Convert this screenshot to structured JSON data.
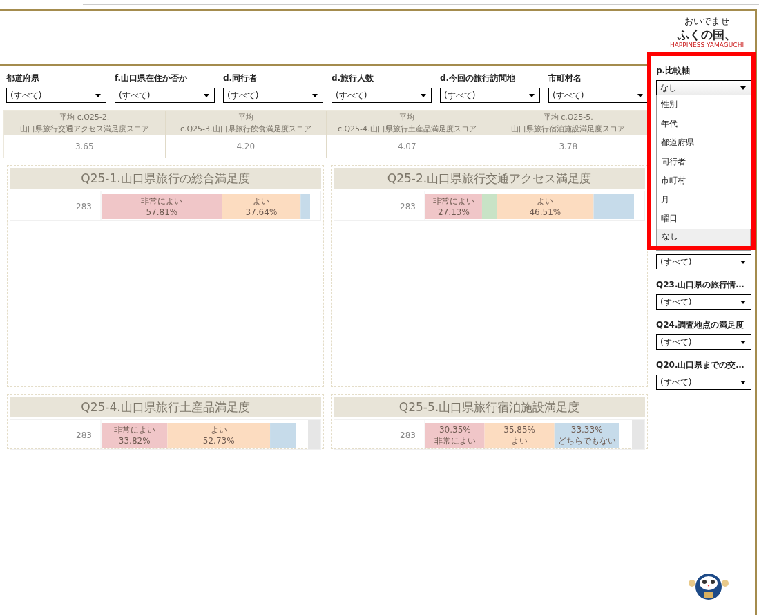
{
  "filters": [
    {
      "label": "都道府県",
      "value": "(すべて)"
    },
    {
      "label": "f.山口県在住か否か",
      "value": "(すべて)"
    },
    {
      "label": "d.同行者",
      "value": "(すべて)"
    },
    {
      "label": "d.旅行人数",
      "value": "(すべて)"
    },
    {
      "label": "d.今回の旅行訪問地",
      "value": "(すべて)"
    },
    {
      "label": "市町村名",
      "value": "(すべて)"
    }
  ],
  "kpi_table": {
    "columns": [
      [
        "平均 c.Q25-2.",
        "山口県旅行交通アクセス満足度スコア"
      ],
      [
        "平均",
        "c.Q25-3.山口県旅行飲食満足度スコア"
      ],
      [
        "平均",
        "c.Q25-4.山口県旅行土産品満足度スコア"
      ],
      [
        "平均 c.Q25-5.",
        "山口県旅行宿泊施設満足度スコア"
      ]
    ],
    "values": [
      "3.65",
      "4.20",
      "4.07",
      "3.78"
    ]
  },
  "panels": [
    {
      "title": "Q25-1.山口県旅行の総合満足度",
      "tall": true,
      "scrollbar": false,
      "value_first": false,
      "chart_data": {
        "type": "bar",
        "orientation": "horizontal",
        "stacked": true,
        "categories": [
          "283"
        ],
        "series": [
          {
            "name": "非常によい",
            "color": "#f0c6c8",
            "values": [
              57.81
            ],
            "value_labels": [
              "57.81%"
            ]
          },
          {
            "name": "よい",
            "color": "#fcdcc0",
            "values": [
              37.64
            ],
            "value_labels": [
              "37.64%"
            ]
          },
          {
            "color": "#c6dbea",
            "values": [
              4.55
            ]
          }
        ]
      }
    },
    {
      "title": "Q25-2.山口県旅行交通アクセス満足度",
      "tall": true,
      "scrollbar": false,
      "value_first": false,
      "chart_data": {
        "type": "bar",
        "orientation": "horizontal",
        "stacked": true,
        "categories": [
          "283"
        ],
        "series": [
          {
            "name": "非常によい",
            "color": "#f0c6c8",
            "values": [
              27.13
            ],
            "value_labels": [
              "27.13%"
            ]
          },
          {
            "color": "#c8e3c6",
            "values": [
              7.0
            ]
          },
          {
            "name": "よい",
            "color": "#fcdcc0",
            "values": [
              46.51
            ],
            "value_labels": [
              "46.51%"
            ]
          },
          {
            "color": "#c6dbea",
            "values": [
              19.36
            ]
          }
        ]
      }
    },
    {
      "title": "Q25-4.山口県旅行土産品満足度",
      "tall": false,
      "scrollbar": true,
      "value_first": false,
      "chart_data": {
        "type": "bar",
        "orientation": "horizontal",
        "stacked": true,
        "categories": [
          "283"
        ],
        "series": [
          {
            "name": "非常によい",
            "color": "#f0c6c8",
            "values": [
              33.82
            ],
            "value_labels": [
              "33.82%"
            ]
          },
          {
            "name": "よい",
            "color": "#fcdcc0",
            "values": [
              52.73
            ],
            "value_labels": [
              "52.73%"
            ]
          },
          {
            "color": "#c6dbea",
            "values": [
              13.45
            ]
          }
        ]
      }
    },
    {
      "title": "Q25-5.山口県旅行宿泊施設満足度",
      "tall": false,
      "scrollbar": true,
      "value_first": true,
      "chart_data": {
        "type": "bar",
        "orientation": "horizontal",
        "stacked": true,
        "categories": [
          "283"
        ],
        "series": [
          {
            "name": "非常によい",
            "color": "#f0c6c8",
            "values": [
              30.35
            ],
            "value_labels": [
              "30.35%"
            ]
          },
          {
            "name": "よい",
            "color": "#fcdcc0",
            "values": [
              35.85
            ],
            "value_labels": [
              "35.85%"
            ]
          },
          {
            "name": "どちらでもない",
            "color": "#c6dbea",
            "values": [
              33.33
            ],
            "value_labels": [
              "33.33%"
            ]
          }
        ]
      }
    }
  ],
  "logo": {
    "small": "おいでませ",
    "main": "ふくの国、",
    "sub": "HAPPINESS YAMAGUCHI"
  },
  "compare_axis": {
    "label": "p.比較軸",
    "value": "なし",
    "expanded": true,
    "options": [
      {
        "label": "性別",
        "selected": false
      },
      {
        "label": "年代",
        "selected": false
      },
      {
        "label": "都道府県",
        "selected": false
      },
      {
        "label": "同行者",
        "selected": false
      },
      {
        "label": "市町村",
        "selected": false
      },
      {
        "label": "月",
        "selected": false
      },
      {
        "label": "曜日",
        "selected": false
      },
      {
        "label": "なし",
        "selected": true
      }
    ],
    "covered_dropdown": "(すべて)"
  },
  "side_filters": [
    {
      "label": "Q23.山口県の旅行情…",
      "value": "(すべて)"
    },
    {
      "label": "Q24.調査地点の満足度",
      "value": "(すべて)"
    },
    {
      "label": "Q20.山口県までの交…",
      "value": "(すべて)"
    }
  ],
  "highlight": true
}
